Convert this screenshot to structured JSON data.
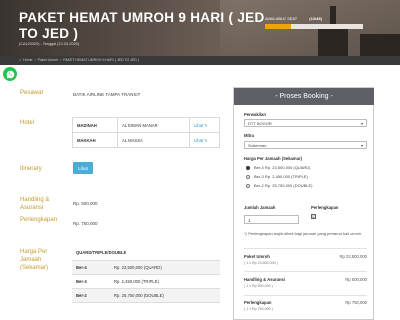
{
  "header": {
    "title": "PAKET HEMAT UMROH 9 HARI ( JED TO JED )",
    "subtitle": "(CA120320) - Tanggal (12-03-2020)",
    "seat_label": "AVAILABLE SEAT",
    "seat_count": "(13/48)",
    "seat_fill_fraction": 0.27
  },
  "breadcrumb": [
    "Home",
    "Paket Umroh",
    "PAKET HEMAT UMROH 9 HARI ( JED TO JED )"
  ],
  "details": {
    "pesawat_label": "Pesawat",
    "pesawat_value": "BATIK AIRLINE TAMPA TRANSIT",
    "hotel_label": "Hotel",
    "hotels": [
      {
        "city": "MADINAH",
        "name": "AL EIMAN MANAR",
        "link": "Lihat ✎"
      },
      {
        "city": "MAKKAH",
        "name": "AL MASSA",
        "link": "Lihat ✎"
      }
    ],
    "itinerary_label": "Itinerary",
    "itinerary_button": "Lihat",
    "handling_label": "Handling & Asuransi",
    "handling_value": "Rp. 500,000",
    "perlengkapan_label": "Perlengkapan",
    "perlengkapan_value": "Rp. 750,000",
    "harga_label": "Harga Per Jamaah (Sekamar)",
    "price_table": {
      "header": "QUARD/TRIPLE/DOUBLE",
      "rows": [
        {
          "bed": "Ber-4",
          "price": "Rp. 23,500,000 (QUARD)"
        },
        {
          "bed": "Ber-3",
          "price": "Rp. 2,450,000 (TRIPLE)"
        },
        {
          "bed": "Ber-2",
          "price": "Rp. 25,750,000 (DOUBLE)"
        }
      ]
    }
  },
  "booking": {
    "title": "Proses Booking",
    "perwakilan_label": "Perwakilan",
    "perwakilan_value": "DTT BOGOR",
    "mitra_label": "Mitra",
    "mitra_value": "Suherman",
    "harga_label": "Harga Per Jamaah (Sekamar)",
    "options": [
      {
        "text": "Ber-4 Rp. 23,500,000 (QUARD)",
        "selected": true
      },
      {
        "text": "Ber-3 Rp. 2,450,000 (TRIPLE)",
        "selected": false
      },
      {
        "text": "Ber-2 Rp. 25,750,000 (DOUBLE)",
        "selected": false
      }
    ],
    "jumlah_label": "Jumlah Jamaah",
    "jumlah_value": "1",
    "perlengkapan_label": "Perlengkapan",
    "perlengkapan_check": "☑",
    "note": "*) Perlengkapan wajib dibeli bagi jamaah yang pertama kali umroh",
    "summary": [
      {
        "title": "Paket Umroh",
        "sub": "( 1 x Rp 23,500,000 )",
        "price": "Rp 23,500,000"
      },
      {
        "title": "Handling & Asuransi",
        "sub": "( 1 x Rp 500,000 )",
        "price": "Rp 500,000"
      },
      {
        "title": "Perlengkapan",
        "sub": "( 1 x Rp 750,000 )",
        "price": "Rp 750,000"
      }
    ]
  },
  "colors": {
    "accent_gold": "#c39a2d",
    "seat_bar": "#f0a20a",
    "whatsapp": "#27c34f",
    "panel_head": "#5f6065"
  }
}
